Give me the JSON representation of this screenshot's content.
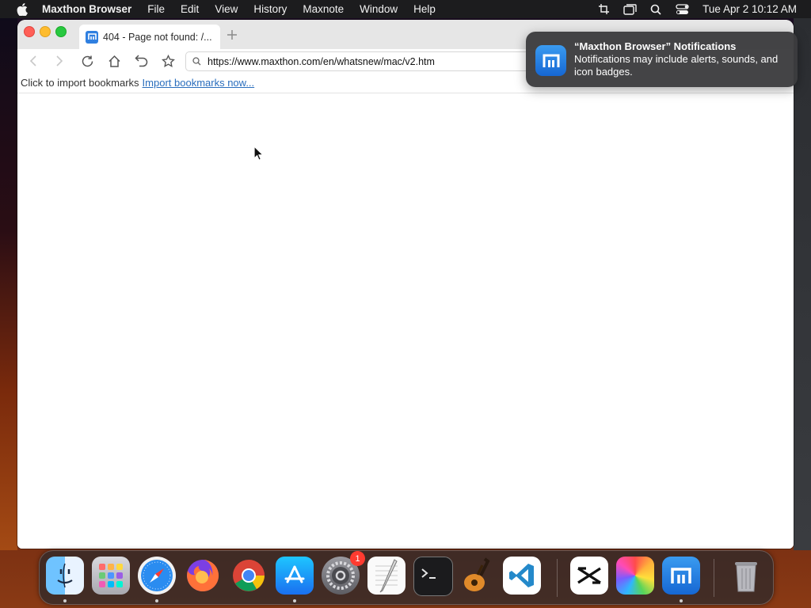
{
  "menubar": {
    "app_name": "Maxthon Browser",
    "items": [
      "File",
      "Edit",
      "View",
      "History",
      "Maxnote",
      "Window",
      "Help"
    ],
    "clock": "Tue Apr 2  10:12 AM",
    "status_icons": [
      "screenshot-crop-icon",
      "screen-mirroring-icon",
      "spotlight-search-icon",
      "control-center-icon"
    ]
  },
  "browser": {
    "tab_title": "404 - Page not found: /...",
    "new_tab_symbol": "+",
    "url": "https://www.maxthon.com/en/whatsnew/mac/v2.htm",
    "bookmarks_prompt": "Click to import bookmarks",
    "bookmarks_link": "Import bookmarks now..."
  },
  "notification": {
    "title": "“Maxthon Browser” Notifications",
    "body": "Notifications may include alerts, sounds, and icon badges."
  },
  "dock": {
    "apps": [
      "Finder",
      "Launchpad",
      "Safari",
      "Firefox",
      "Chrome",
      "App Store",
      "System Settings",
      "TextEdit",
      "Terminal",
      "GarageBand",
      "Visual Studio Code",
      "CapCut",
      "Photos",
      "Maxthon",
      "Trash"
    ],
    "system_settings_badge": "1"
  },
  "colors": {
    "accent_blue": "#2f7fe0",
    "link": "#2a6ebd",
    "badge_red": "#ff3b30"
  }
}
